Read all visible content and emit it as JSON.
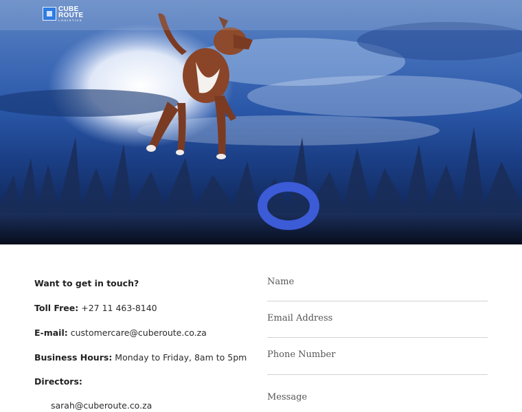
{
  "brand": {
    "logo_line1": "CUBE",
    "logo_line2": "ROUTE",
    "logo_line3": "LOGISTICS",
    "accent_color": "#2f7be0"
  },
  "hero": {
    "image_subject": "dog jumping over grass field at dusk with blue ring toy",
    "dominant_color": "#2a57a8"
  },
  "contact": {
    "heading": "Want to get in touch?",
    "toll_free_label": "Toll Free:",
    "toll_free_value": "+27 11 463-8140",
    "email_label": "E-mail:",
    "email_value": "customercare@cuberoute.co.za",
    "hours_label": "Business Hours:",
    "hours_value": "Monday to Friday, 8am to 5pm",
    "directors_label": "Directors:",
    "directors": [
      "sarah@cuberoute.co.za"
    ]
  },
  "form": {
    "name_placeholder": "Name",
    "email_placeholder": "Email Address",
    "phone_placeholder": "Phone Number",
    "message_placeholder": "Message"
  }
}
